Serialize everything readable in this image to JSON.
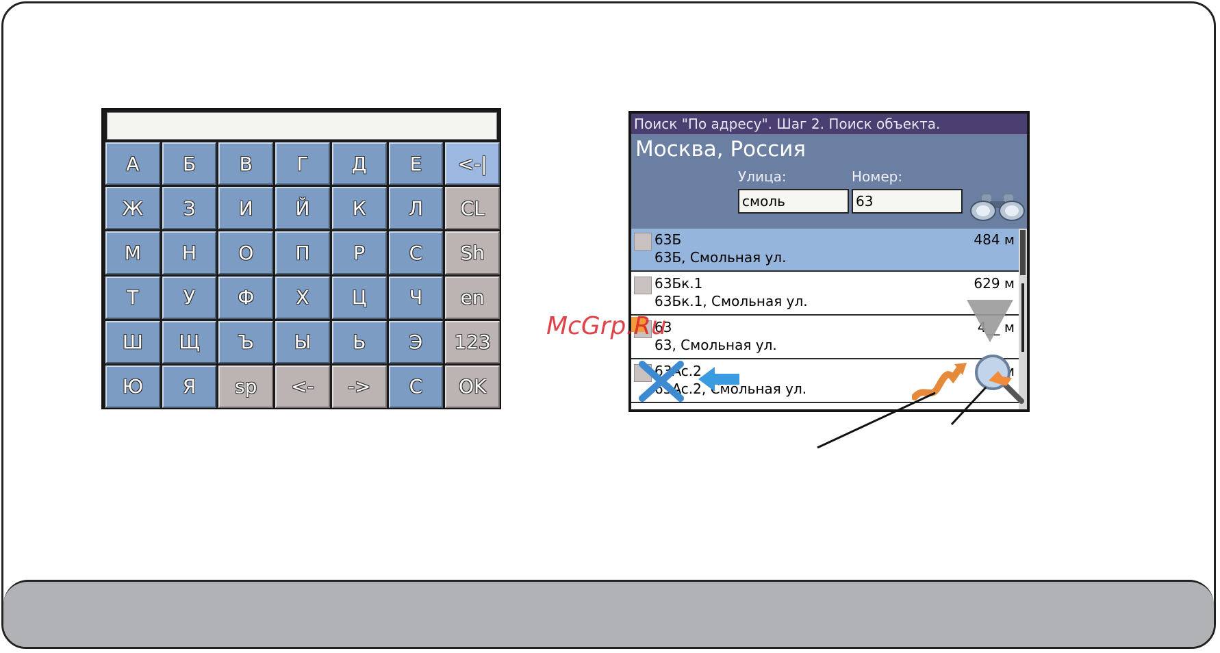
{
  "keyboard": {
    "input_value": "",
    "keys": [
      {
        "label": "А",
        "style": "blue"
      },
      {
        "label": "Б",
        "style": "blue"
      },
      {
        "label": "В",
        "style": "blue"
      },
      {
        "label": "Г",
        "style": "blue"
      },
      {
        "label": "Д",
        "style": "blue"
      },
      {
        "label": "Е",
        "style": "blue"
      },
      {
        "label": "<-|",
        "style": "light"
      },
      {
        "label": "Ж",
        "style": "blue"
      },
      {
        "label": "З",
        "style": "blue"
      },
      {
        "label": "И",
        "style": "blue"
      },
      {
        "label": "Й",
        "style": "blue"
      },
      {
        "label": "К",
        "style": "blue"
      },
      {
        "label": "Л",
        "style": "blue"
      },
      {
        "label": "CL",
        "style": "gray"
      },
      {
        "label": "М",
        "style": "blue"
      },
      {
        "label": "Н",
        "style": "blue"
      },
      {
        "label": "О",
        "style": "blue"
      },
      {
        "label": "П",
        "style": "blue"
      },
      {
        "label": "Р",
        "style": "blue"
      },
      {
        "label": "С",
        "style": "blue"
      },
      {
        "label": "Sh",
        "style": "gray"
      },
      {
        "label": "Т",
        "style": "blue"
      },
      {
        "label": "У",
        "style": "blue"
      },
      {
        "label": "Ф",
        "style": "blue"
      },
      {
        "label": "Х",
        "style": "blue"
      },
      {
        "label": "Ц",
        "style": "blue"
      },
      {
        "label": "Ч",
        "style": "blue"
      },
      {
        "label": "en",
        "style": "gray"
      },
      {
        "label": "Ш",
        "style": "blue"
      },
      {
        "label": "Щ",
        "style": "blue"
      },
      {
        "label": "Ъ",
        "style": "blue"
      },
      {
        "label": "Ы",
        "style": "blue"
      },
      {
        "label": "Ь",
        "style": "blue"
      },
      {
        "label": "Э",
        "style": "blue"
      },
      {
        "label": "123",
        "style": "gray"
      },
      {
        "label": "Ю",
        "style": "blue"
      },
      {
        "label": "Я",
        "style": "blue"
      },
      {
        "label": "sp",
        "style": "gray"
      },
      {
        "label": "<-",
        "style": "gray"
      },
      {
        "label": "->",
        "style": "gray"
      },
      {
        "label": "C",
        "style": "blue"
      },
      {
        "label": "OK",
        "style": "gray"
      }
    ]
  },
  "search": {
    "title": "Поиск \"По адресу\". Шаг 2. Поиск объекта.",
    "city": "Москва, Россия",
    "street_label": "Улица:",
    "number_label": "Номер:",
    "street_value": "смоль",
    "number_value": "63",
    "results": [
      {
        "number": "63Б",
        "address": "63Б, Смольная ул.",
        "distance": "484 м",
        "selected": true
      },
      {
        "number": "63Бк.1",
        "address": "63Бк.1, Смольная ул.",
        "distance": "629 м",
        "selected": false
      },
      {
        "number": "63",
        "address": "63, Смольная ул.",
        "distance": "4__ м",
        "selected": false
      },
      {
        "number": "63Ac.2",
        "address": "63Ac.2, Смольная ул.",
        "distance": "__ м",
        "selected": false
      }
    ]
  },
  "watermark": "McGrp.Ru",
  "colors": {
    "title_bar": "#4b3f72",
    "header": "#6a7fa1",
    "selected_row": "#95b5dd",
    "key_blue": "#7d9cc3",
    "key_gray": "#bcb3b3",
    "footer_band": "#b1b2b5"
  },
  "icons": [
    "binoculars-icon",
    "scroll-down-arrow-icon",
    "cancel-x-icon",
    "back-arrow-icon",
    "route-icon",
    "show-on-map-icon"
  ]
}
